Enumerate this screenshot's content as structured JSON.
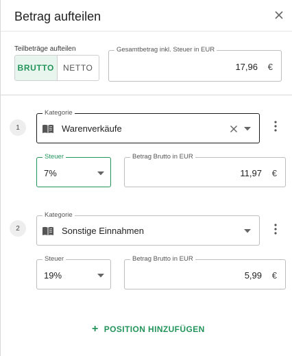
{
  "dialog": {
    "title": "Betrag aufteilen"
  },
  "split_mode": {
    "label": "Teilbeträge aufteilen",
    "options": [
      "BRUTTO",
      "NETTO"
    ],
    "selected": "BRUTTO"
  },
  "total": {
    "label": "Gesamtbetrag inkl. Steuer in EUR",
    "value": "17,96",
    "unit": "€"
  },
  "positions": [
    {
      "number": "1",
      "category_label": "Kategorie",
      "category_value": "Warenverkäufe",
      "category_icon": "book-icon",
      "tax_label": "Steuer",
      "tax_value": "7%",
      "amount_label": "Betrag Brutto in EUR",
      "amount_value": "11,97",
      "amount_unit": "€"
    },
    {
      "number": "2",
      "category_label": "Kategorie",
      "category_value": "Sonstige Einnahmen",
      "category_icon": "book-icon",
      "tax_label": "Steuer",
      "tax_value": "19%",
      "amount_label": "Betrag Brutto in EUR",
      "amount_value": "5,99",
      "amount_unit": "€"
    }
  ],
  "add_position": {
    "icon": "+",
    "label": "POSITION HINZUFÜGEN"
  },
  "colors": {
    "accent": "#22945a",
    "accent_bg": "#e8f5ee",
    "border": "#bdbdbd",
    "focus_border": "#1a1a1a"
  }
}
